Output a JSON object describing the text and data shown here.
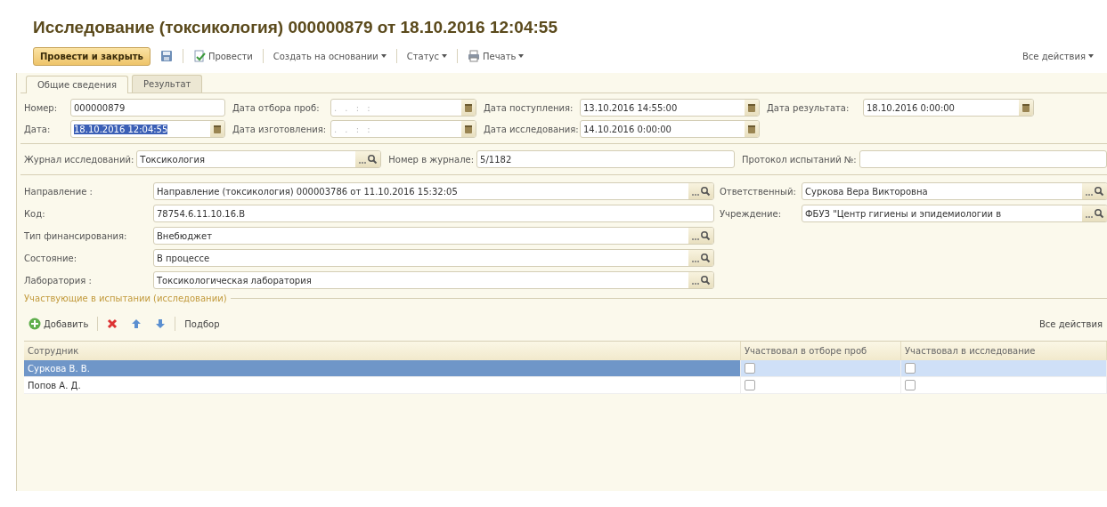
{
  "window": {
    "title": "Исследование (токсикология) 000000879 от 18.10.2016 12:04:55"
  },
  "toolbar": {
    "items": [
      {
        "kind": "primary",
        "label": "Провести и закрыть"
      },
      {
        "kind": "save"
      },
      {
        "kind": "post",
        "label": "Провести"
      },
      {
        "kind": "menu",
        "label": "Создать на основании"
      },
      {
        "kind": "menu",
        "label": "Статус"
      },
      {
        "kind": "print",
        "label": "Печать"
      }
    ],
    "all_actions": "Все действия"
  },
  "tabs": [
    {
      "label": "Общие сведения",
      "selected": true
    },
    {
      "label": "Результат",
      "selected": false
    }
  ],
  "dates": [
    {
      "label": "Номер:",
      "value": "000000879",
      "kind": "text"
    },
    {
      "label": "Дата отбора проб:",
      "placeholder": ". .   : :",
      "kind": "date"
    },
    {
      "label": "Дата поступления:",
      "value": "13.10.2016 14:55:00",
      "kind": "date"
    },
    {
      "label": "Дата результата:",
      "value": "18.10.2016  0:00:00",
      "kind": "date"
    },
    {
      "label": "Дата:",
      "value": "18.10.2016 12:04:55",
      "kind": "date",
      "highlighted": true
    },
    {
      "label": "Дата изготовления:",
      "placeholder": ". .   : :",
      "kind": "date"
    },
    {
      "label": "Дата исследования:",
      "value": "14.10.2016  0:00:00",
      "kind": "date"
    }
  ],
  "journal": [
    {
      "label": "Журнал исследований:",
      "value": "Токсикология",
      "kind": "choice"
    },
    {
      "label": "Номер в журнале:",
      "value": "5/1182",
      "kind": "text"
    },
    {
      "label": "Протокол испытаний №:",
      "kind": "text"
    }
  ],
  "details": [
    {
      "label": "Направление :",
      "value": "Направление (токсикология) 000003786 от 11.10.2016 15:32:05",
      "kind": "choice"
    },
    {
      "label": "Ответственный:",
      "value": "Суркова Вера Викторовна",
      "kind": "choice"
    },
    {
      "label": "Код:",
      "value": "78754.6.11.10.16.В",
      "kind": "text"
    },
    {
      "label": "Учреждение:",
      "value": "ФБУЗ \"Центр гигиены и эпидемиологии в",
      "kind": "choice"
    },
    {
      "label": "Тип финансирования:",
      "value": "Внебюджет",
      "kind": "choice"
    },
    {
      "label": "Состояние:",
      "value": "В процессе",
      "kind": "choice"
    },
    {
      "label": "Лаборатория :",
      "value": "Токсикологическая лаборатория",
      "kind": "choice"
    }
  ],
  "participants": {
    "title": "Участвующие в испытании (исследовании)",
    "toolbar": [
      {
        "kind": "add",
        "label": "Добавить"
      },
      {
        "kind": "delete"
      },
      {
        "kind": "up"
      },
      {
        "kind": "down"
      },
      {
        "kind": "pick",
        "label": "Подбор"
      }
    ],
    "all_actions": "Все действия",
    "columns": [
      "Сотрудник",
      "Участвовал в отборе проб",
      "Участвовал в исследование"
    ],
    "rows": [
      {
        "name": "Суркова В. В.",
        "selected": true,
        "sampling": false,
        "research": false
      },
      {
        "name": "Попов  А. Д.",
        "selected": false,
        "sampling": false,
        "research": false
      }
    ]
  }
}
